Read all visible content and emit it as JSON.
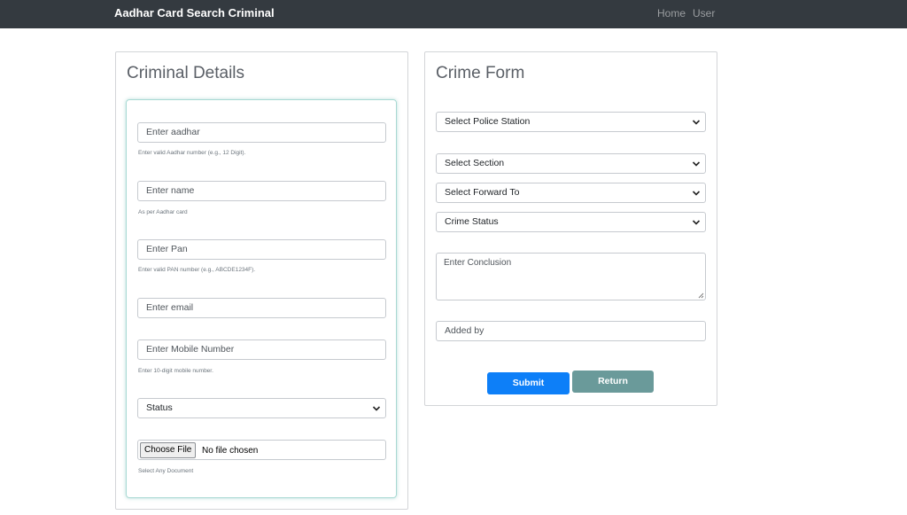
{
  "navbar": {
    "brand": "Aadhar Card Search Criminal",
    "links": [
      "Home",
      "User"
    ]
  },
  "criminal_details": {
    "title": "Criminal Details",
    "aadhar": {
      "placeholder": "Enter aadhar",
      "help": "Enter valid Aadhar number (e.g., 12 Digit)."
    },
    "name": {
      "placeholder": "Enter name",
      "help": "As per Aadhar card"
    },
    "pan": {
      "placeholder": "Enter Pan",
      "help": "Enter valid PAN number (e.g., ABCDE1234F)."
    },
    "email": {
      "placeholder": "Enter email"
    },
    "mobile": {
      "placeholder": "Enter Mobile Number",
      "help": "Enter 10-digit mobile number."
    },
    "status": {
      "selected": "Status"
    },
    "file": {
      "button": "Choose File",
      "status": "No file chosen",
      "help": "Select Any Document"
    }
  },
  "crime_form": {
    "title": "Crime Form",
    "police_station": "Select Police Station",
    "section": "Select Section",
    "forward_to": "Select Forward To",
    "crime_status": "Crime Status",
    "conclusion_placeholder": "Enter Conclusion",
    "added_by_placeholder": "Added by",
    "submit_label": "Submit",
    "return_label": "Return"
  },
  "colors": {
    "navbar": "#343a40",
    "submit": "#0d7ff8",
    "return": "#6a9a9a",
    "inner_border": "#a8d9d3"
  },
  "icons": {
    "select": "chevron-down-icon",
    "textarea": "resize-handle-icon"
  }
}
